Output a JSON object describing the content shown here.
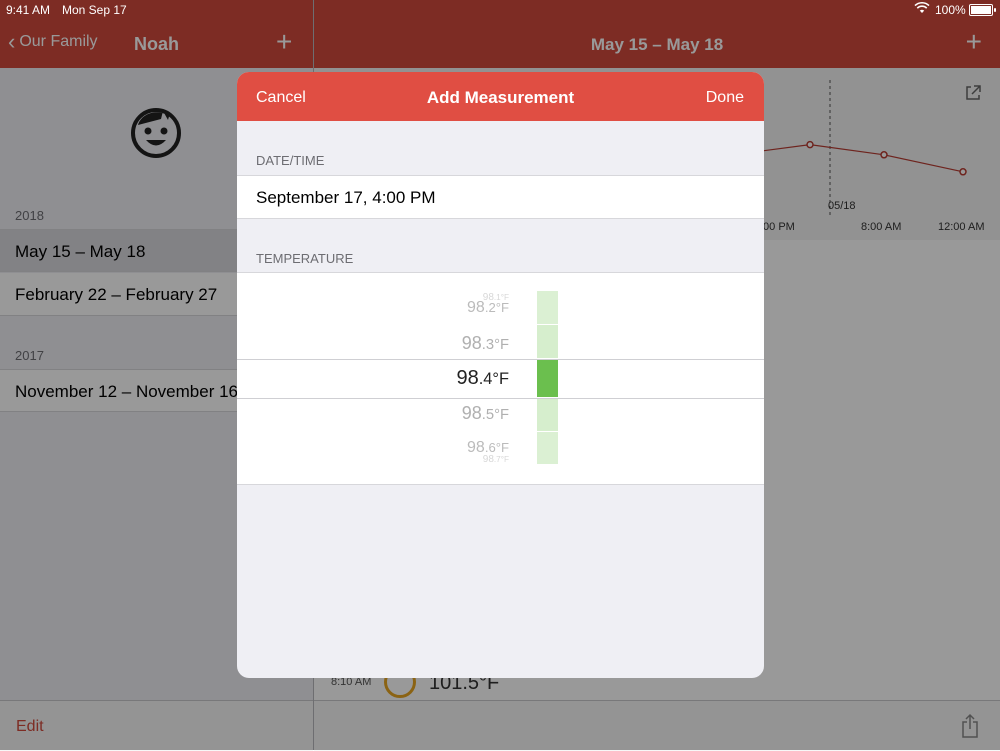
{
  "status": {
    "time": "9:41 AM",
    "date": "Mon Sep 17",
    "battery": "100%"
  },
  "left": {
    "back_label": "Our Family",
    "title": "Noah",
    "add": "+",
    "sections": [
      {
        "header": "2018",
        "rows": [
          "May 15 – May 18",
          "February 22 – February 27"
        ]
      },
      {
        "header": "2017",
        "rows": [
          "November 12 – November 16"
        ]
      }
    ],
    "edit": "Edit"
  },
  "right": {
    "title": "May 15 – May 18",
    "add": "+",
    "chart_data": {
      "type": "line",
      "x_ticks": [
        ":00 PM",
        "8:00 AM",
        "12:00 AM"
      ],
      "marker_label": "05/18",
      "series": [
        {
          "values": [
            99.6,
            99.3,
            98.8
          ]
        }
      ],
      "color": "#b83c33"
    },
    "reading": {
      "time": "8:10 AM",
      "value": "101.5°F"
    }
  },
  "modal": {
    "cancel": "Cancel",
    "title": "Add Measurement",
    "done": "Done",
    "datetime_header": "DATE/TIME",
    "datetime_value": "September 17, 4:00 PM",
    "temperature_header": "TEMPERATURE",
    "picker": {
      "items": [
        {
          "num": "98",
          "dec": ".1",
          "unit": "°F"
        },
        {
          "num": "98",
          "dec": ".2",
          "unit": "°F"
        },
        {
          "num": "98",
          "dec": ".3",
          "unit": "°F"
        },
        {
          "num": "98",
          "dec": ".4",
          "unit": "°F"
        },
        {
          "num": "98",
          "dec": ".5",
          "unit": "°F"
        },
        {
          "num": "98",
          "dec": ".6",
          "unit": "°F"
        },
        {
          "num": "98",
          "dec": ".7",
          "unit": "°F"
        }
      ],
      "selected_index": 3
    }
  },
  "colors": {
    "accent": "#d14a3c",
    "modal_bar": "#e04e43",
    "heat_selected": "#6bbf4e",
    "heat_light": "#d3edc9"
  }
}
